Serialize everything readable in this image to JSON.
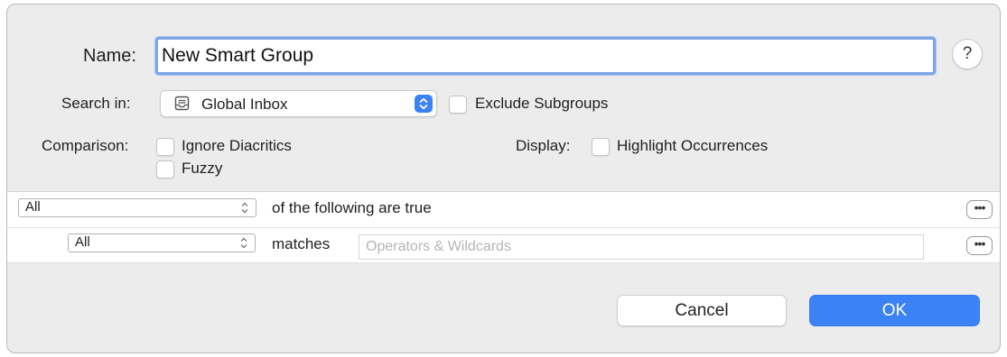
{
  "name": {
    "label": "Name:",
    "value": "New Smart Group"
  },
  "help": {
    "label": "?"
  },
  "search_in": {
    "label": "Search in:",
    "selected": "Global Inbox"
  },
  "exclude_subgroups": {
    "label": "Exclude Subgroups",
    "checked": false
  },
  "comparison": {
    "label": "Comparison:",
    "options": [
      {
        "label": "Ignore Diacritics",
        "checked": false
      },
      {
        "label": "Fuzzy",
        "checked": false
      }
    ]
  },
  "display": {
    "label": "Display:",
    "option": {
      "label": "Highlight Occurrences",
      "checked": false
    }
  },
  "rules": {
    "top": {
      "selected": "All",
      "text": "of the following are true",
      "more_label": "•••"
    },
    "criterion": {
      "selected": "All",
      "operator": "matches",
      "placeholder": "Operators & Wildcards",
      "more_label": "•••"
    }
  },
  "buttons": {
    "cancel": "Cancel",
    "ok": "OK"
  },
  "colors": {
    "accent": "#3b82f6",
    "focus_ring": "#7ea6e6"
  }
}
